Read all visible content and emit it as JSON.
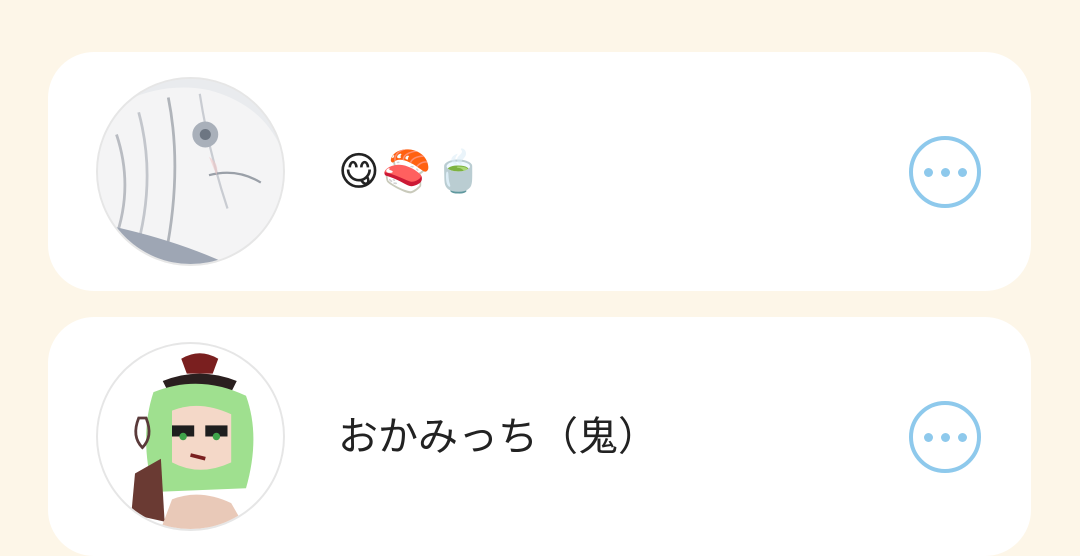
{
  "contacts": [
    {
      "display_name": "😋🍣🍵",
      "avatar": "avatar-white-haired-character",
      "menu_icon": "more-options-icon"
    },
    {
      "display_name": "おかみっち（鬼）",
      "avatar": "avatar-green-haired-character",
      "menu_icon": "more-options-icon"
    }
  ],
  "colors": {
    "background": "#fdf6e8",
    "card": "#ffffff",
    "accent": "#8ec9ec",
    "text": "#222222"
  }
}
